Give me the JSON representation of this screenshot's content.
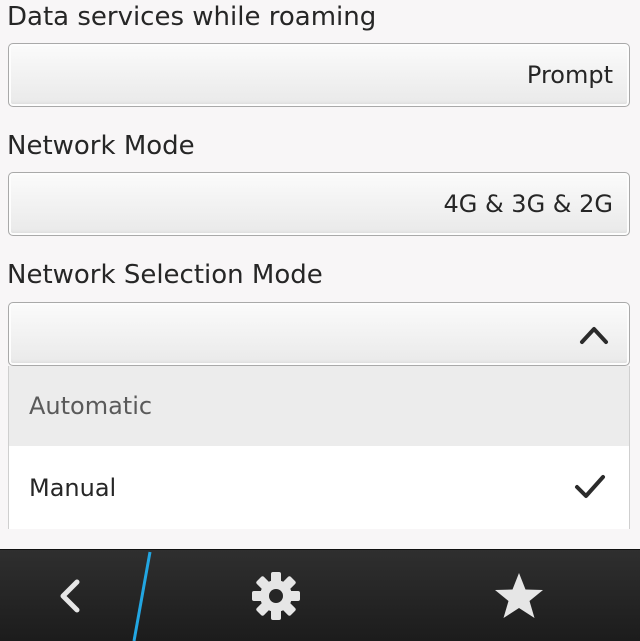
{
  "settings": {
    "roaming": {
      "label": "Data services while roaming",
      "value": "Prompt"
    },
    "network_mode": {
      "label": "Network Mode",
      "value": "4G & 3G & 2G"
    },
    "selection_mode": {
      "label": "Network Selection Mode",
      "options": [
        {
          "label": "Automatic",
          "selected": false
        },
        {
          "label": "Manual",
          "selected": true
        }
      ]
    }
  },
  "toolbar": {
    "icons": [
      "back-icon",
      "gear-icon",
      "star-icon"
    ]
  },
  "colors": {
    "accent_divider": "#22a6e2",
    "toolbar_bg": "#262626",
    "icon": "#e6e6e6"
  }
}
